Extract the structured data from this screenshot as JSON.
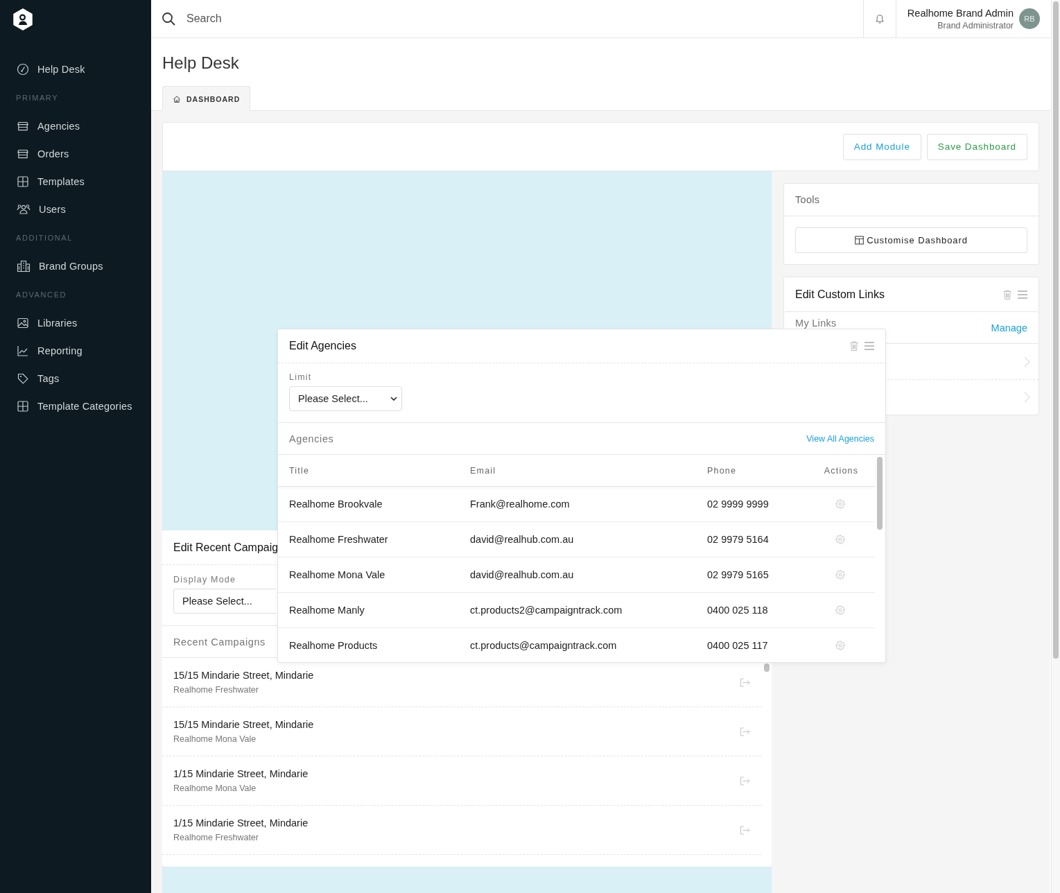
{
  "sidebar": {
    "items": [
      {
        "kind": "link",
        "label": "Help Desk"
      },
      {
        "kind": "heading",
        "label": "PRIMARY"
      },
      {
        "kind": "link",
        "label": "Agencies"
      },
      {
        "kind": "link",
        "label": "Orders"
      },
      {
        "kind": "link",
        "label": "Templates"
      },
      {
        "kind": "link",
        "label": "Users"
      },
      {
        "kind": "heading",
        "label": "ADDITIONAL"
      },
      {
        "kind": "link",
        "label": "Brand Groups"
      },
      {
        "kind": "heading",
        "label": "ADVANCED"
      },
      {
        "kind": "link",
        "label": "Libraries"
      },
      {
        "kind": "link",
        "label": "Reporting"
      },
      {
        "kind": "link",
        "label": "Tags"
      },
      {
        "kind": "link",
        "label": "Template Categories"
      }
    ]
  },
  "header": {
    "search": {
      "placeholder": "Search"
    },
    "user": {
      "name": "Realhome Brand Admin",
      "role": "Brand Administrator",
      "initials": "RB"
    }
  },
  "page": {
    "title": "Help Desk",
    "tabs": [
      {
        "label": "DASHBOARD",
        "selected": true
      }
    ]
  },
  "toolbar": {
    "buttons": [
      {
        "label": "Add Module",
        "color": "#1ba1d8"
      },
      {
        "label": "Save Dashboard",
        "color": "#2a9d4a"
      }
    ]
  },
  "tools": {
    "title": "Tools",
    "button": "Customise Dashboard"
  },
  "custom_links": {
    "title": "Edit Custom Links",
    "section": "My Links",
    "action": "Manage"
  },
  "agencies_module": {
    "title": "Edit Agencies",
    "limit": {
      "label": "Limit",
      "value": "Please Select..."
    },
    "section": "Agencies",
    "link": "View All Agencies",
    "columns": [
      "Title",
      "Email",
      "Phone",
      "Actions"
    ],
    "rows": [
      {
        "title": "Realhome Brookvale",
        "email": "Frank@realhome.com",
        "phone": "02 9999 9999"
      },
      {
        "title": "Realhome Freshwater",
        "email": "david@realhub.com.au",
        "phone": "02 9979 5164"
      },
      {
        "title": "Realhome Mona Vale",
        "email": "david@realhub.com.au",
        "phone": "02 9979 5165"
      },
      {
        "title": "Realhome Manly",
        "email": "ct.products2@campaigntrack.com",
        "phone": "0400 025 118"
      },
      {
        "title": "Realhome Products",
        "email": "ct.products@campaigntrack.com",
        "phone": "0400 025 117"
      }
    ]
  },
  "campaigns_module": {
    "title": "Edit Recent Campaig",
    "display_mode": {
      "label": "Display Mode",
      "value": "Please Select..."
    },
    "section": "Recent Campaigns",
    "items": [
      {
        "address": "15/15 Mindarie Street, Mindarie",
        "agency": "Realhome Freshwater"
      },
      {
        "address": "15/15 Mindarie Street, Mindarie",
        "agency": "Realhome Mona Vale"
      },
      {
        "address": "1/15 Mindarie Street, Mindarie",
        "agency": "Realhome Mona Vale"
      },
      {
        "address": "1/15 Mindarie Street, Mindarie",
        "agency": "Realhome Freshwater"
      }
    ]
  }
}
